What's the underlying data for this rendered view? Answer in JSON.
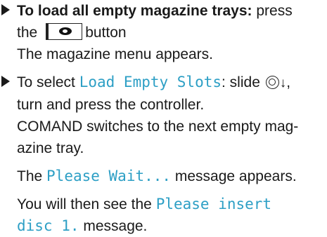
{
  "step1": {
    "title": "To load all empty magazine trays:",
    "text_press": " press",
    "text_the": "the",
    "button_label": "button",
    "result": "The magazine menu appears."
  },
  "step2": {
    "text_prefix": "To select ",
    "option": "Load Empty Slots",
    "text_slide": ": slide ",
    "arrow": "↓",
    "text_after_arrow": ",",
    "line2": "turn and press the controller.",
    "line3": "COMAND switches to the next empty mag-",
    "line4": "azine tray.",
    "text_the": "The ",
    "message_wait": "Please Wait...",
    "text_message_appears": " message appears.",
    "text_you_will": "You will then see the ",
    "message_insert_1": "Please insert",
    "message_insert_2": "disc 1.",
    "text_message": " message."
  },
  "icons": {
    "bullet": "triangle-bullet-icon",
    "disc_button": "disc-button-icon",
    "controller": "controller-icon",
    "arrow": "down-arrow-icon"
  },
  "colors": {
    "display_text": "#2d9fc5",
    "body_text": "#1a1a1a"
  }
}
